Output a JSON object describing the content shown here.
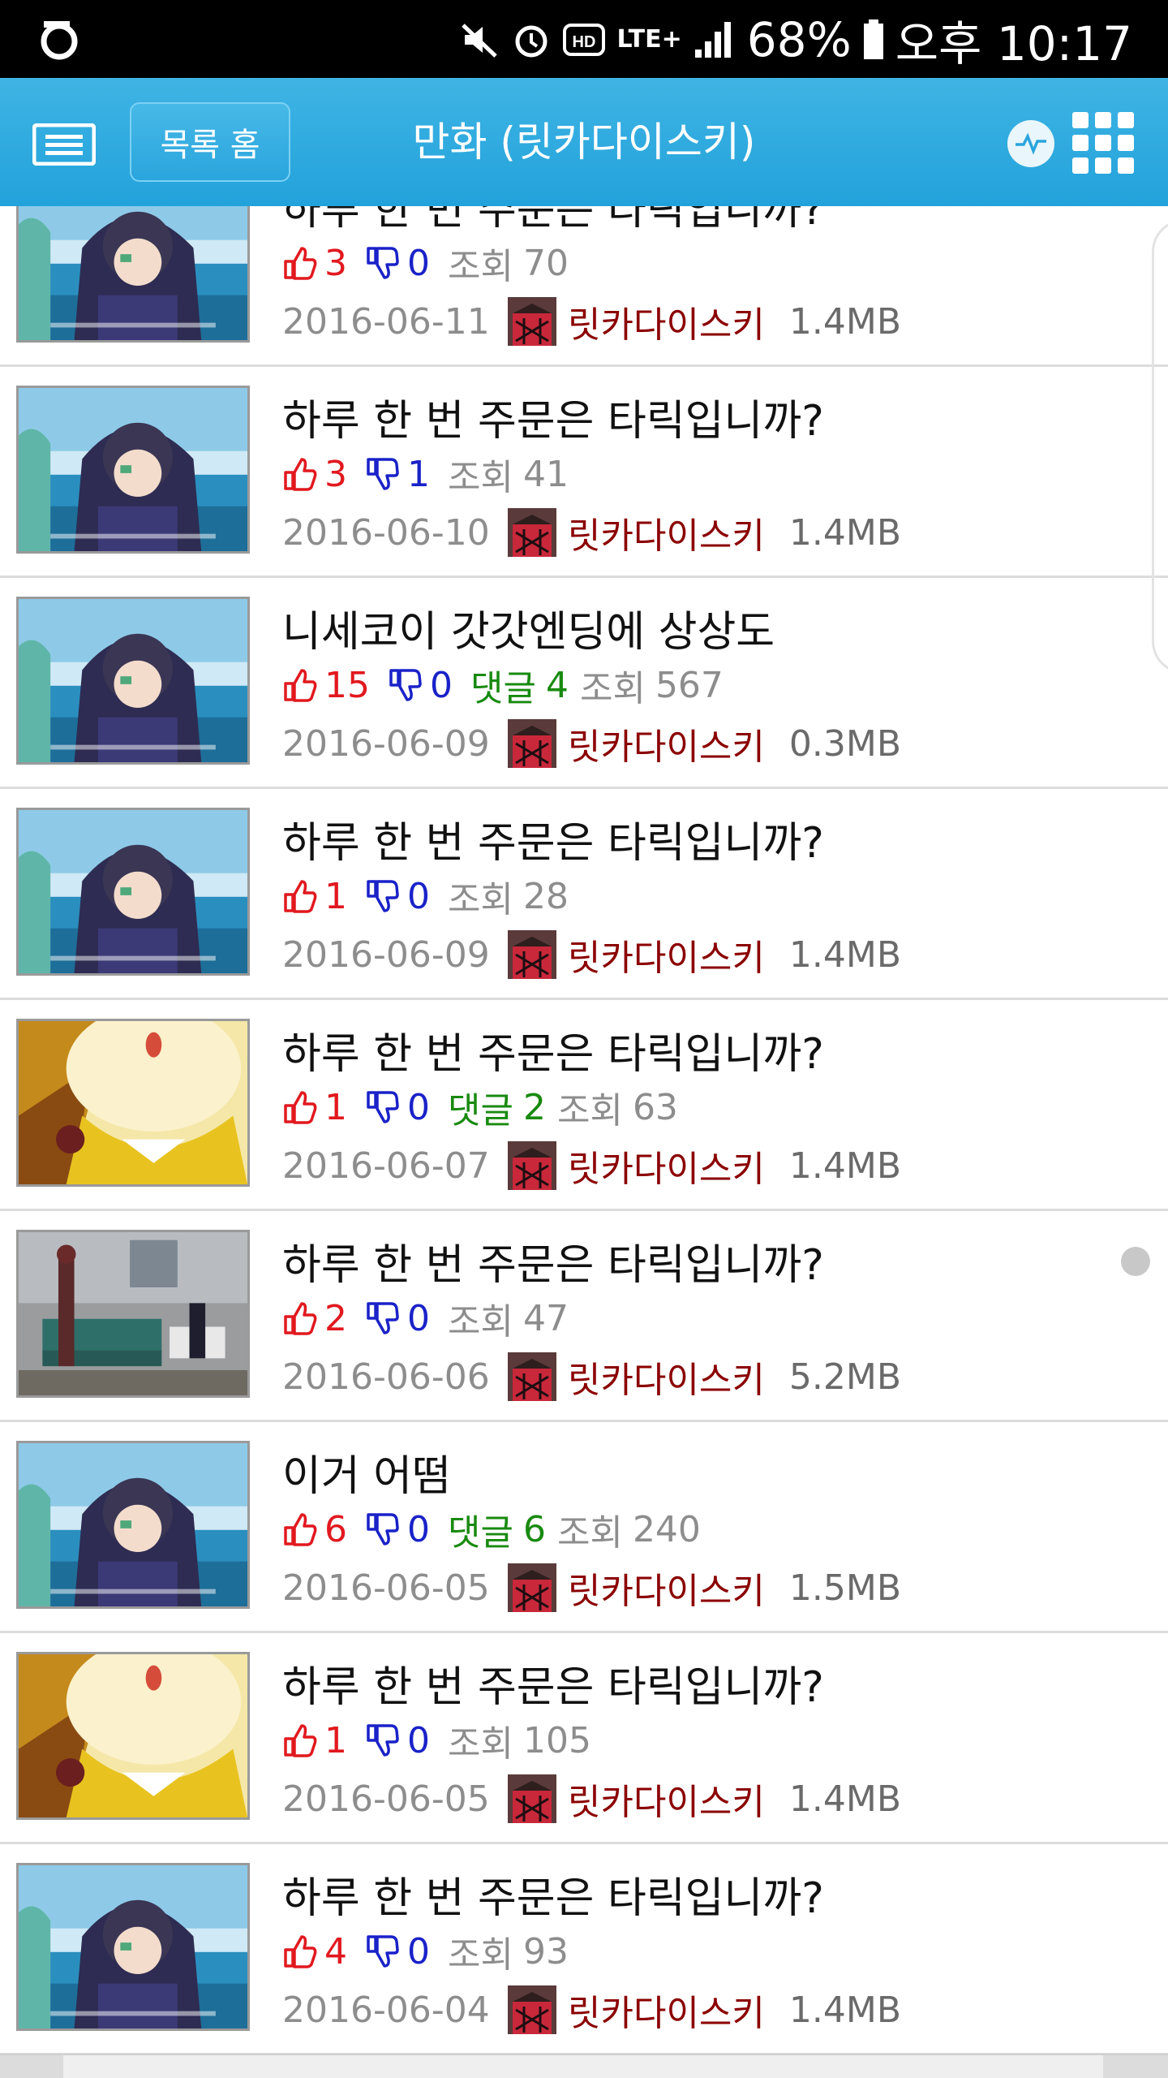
{
  "status_bar": {
    "battery": "68%",
    "time": "오후 10:17",
    "lte": "LTE+",
    "hd": "HD"
  },
  "header": {
    "home_label": "목록 홈",
    "title": "만화  (릿카다이스키)"
  },
  "colors": {
    "header": "#22a2db",
    "likes": "#e1191f",
    "dislikes": "#1a22c8",
    "comments": "#198a10",
    "author": "#8b0000"
  },
  "labels": {
    "comment": "댓글",
    "view": "조회"
  },
  "posts": [
    {
      "title": "하루 한 번 주문은 타릭입니까?",
      "likes": "3",
      "dislikes": "0",
      "comments": "",
      "views": "70",
      "date": "2016-06-11",
      "author": "릿카다이스키",
      "size": "1.4MB",
      "thumb": "rikka"
    },
    {
      "title": "하루 한 번 주문은 타릭입니까?",
      "likes": "3",
      "dislikes": "1",
      "comments": "",
      "views": "41",
      "date": "2016-06-10",
      "author": "릿카다이스키",
      "size": "1.4MB",
      "thumb": "rikka"
    },
    {
      "title": "니세코이 갓갓엔딩에 상상도",
      "likes": "15",
      "dislikes": "0",
      "comments": "4",
      "views": "567",
      "date": "2016-06-09",
      "author": "릿카다이스키",
      "size": "0.3MB",
      "thumb": "rikka"
    },
    {
      "title": "하루 한 번 주문은 타릭입니까?",
      "likes": "1",
      "dislikes": "0",
      "comments": "",
      "views": "28",
      "date": "2016-06-09",
      "author": "릿카다이스키",
      "size": "1.4MB",
      "thumb": "rikka"
    },
    {
      "title": "하루 한 번 주문은 타릭입니까?",
      "likes": "1",
      "dislikes": "0",
      "comments": "2",
      "views": "63",
      "date": "2016-06-07",
      "author": "릿카다이스키",
      "size": "1.4MB",
      "thumb": "yellow"
    },
    {
      "title": "하루 한 번 주문은 타릭입니까?",
      "likes": "2",
      "dislikes": "0",
      "comments": "",
      "views": "47",
      "date": "2016-06-06",
      "author": "릿카다이스키",
      "size": "5.2MB",
      "thumb": "room"
    },
    {
      "title": "이거 어떰",
      "likes": "6",
      "dislikes": "0",
      "comments": "6",
      "views": "240",
      "date": "2016-06-05",
      "author": "릿카다이스키",
      "size": "1.5MB",
      "thumb": "rikka"
    },
    {
      "title": "하루 한 번 주문은 타릭입니까?",
      "likes": "1",
      "dislikes": "0",
      "comments": "",
      "views": "105",
      "date": "2016-06-05",
      "author": "릿카다이스키",
      "size": "1.4MB",
      "thumb": "yellow"
    },
    {
      "title": "하루 한 번 주문은 타릭입니까?",
      "likes": "4",
      "dislikes": "0",
      "comments": "",
      "views": "93",
      "date": "2016-06-04",
      "author": "릿카다이스키",
      "size": "1.4MB",
      "thumb": "rikka"
    }
  ]
}
